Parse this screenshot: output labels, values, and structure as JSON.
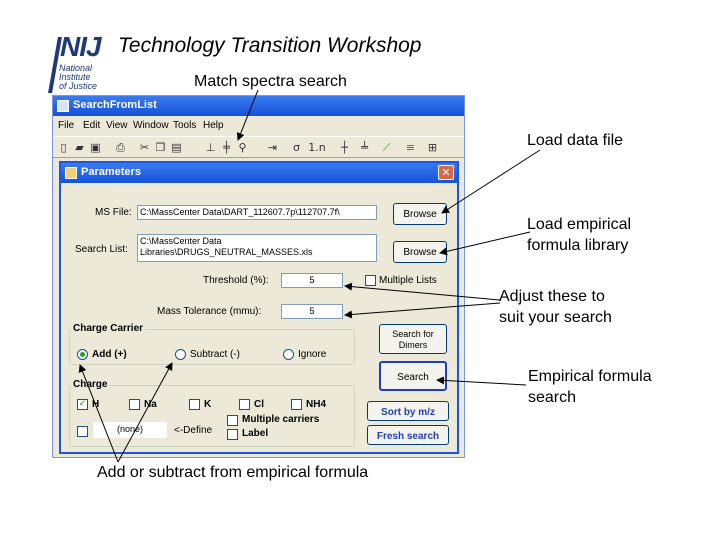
{
  "slide": {
    "title": "Technology Transition Workshop",
    "logo": {
      "mark": "NIJ",
      "lines": [
        "National",
        "Institute",
        "of Justice"
      ]
    }
  },
  "callouts": {
    "match_spectra": "Match spectra search",
    "load_data": "Load data file",
    "load_library": [
      "Load empirical",
      "formula library"
    ],
    "adjust": [
      "Adjust these to",
      "suit your search"
    ],
    "empirical_search": [
      "Empirical formula",
      "search"
    ],
    "add_subtract": "Add or subtract from empirical formula"
  },
  "app": {
    "title": "SearchFromList",
    "menu": [
      "File",
      "Edit",
      "View",
      "Window",
      "Tools",
      "Help"
    ],
    "toolbar_icons": [
      "new-icon",
      "open-icon",
      "save-icon",
      "print-icon",
      "cut-icon",
      "copy-icon",
      "paste-icon",
      "spectrum-icon",
      "peaks-icon",
      "search-icon",
      "arrow-icon",
      "formula-icon",
      "one-n-icon",
      "chart-a-icon",
      "chart-b-icon",
      "chart-c-icon",
      "chart-d-icon",
      "chart-e-icon"
    ]
  },
  "dialog": {
    "title": "Parameters",
    "ms_file_label": "MS File:",
    "ms_file_value": "C:\\MassCenter Data\\DART_112607.7p\\112707.7f\\",
    "browse_label": "Browse",
    "search_list_label": "Search List:",
    "search_list_value": [
      "C:\\MassCenter Data",
      "Libraries\\DRUGS_NEUTRAL_MASSES.xls"
    ],
    "threshold_label": "Threshold (%):",
    "threshold_value": "5",
    "multiple_lists_label": "Multiple Lists",
    "mass_tolerance_label": "Mass Tolerance (mmu):",
    "mass_tolerance_value": "5",
    "charge_carrier_title": "Charge Carrier",
    "carrier_options": [
      "Add (+)",
      "Subtract (-)",
      "Ignore"
    ],
    "search_dimers_label": [
      "Search for",
      "Dimers"
    ],
    "search_label": "Search",
    "charge_title": "Charge",
    "charge_options": [
      "H",
      "Na",
      "K",
      "Cl",
      "NH4"
    ],
    "charge_checked": "H",
    "custom_value": "(none)",
    "define_label": "<-Define",
    "multiple_carriers_label": "Multiple carriers",
    "label_label": "Label",
    "sort_label": "Sort by m/z",
    "fresh_search_label": "Fresh search"
  }
}
